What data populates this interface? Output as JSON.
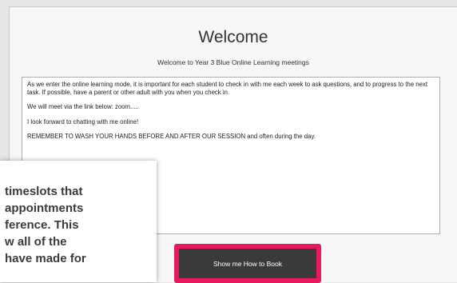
{
  "page": {
    "title": "Welcome",
    "subtitle": "Welcome to Year 3 Blue Online Learning meetings"
  },
  "message": {
    "paragraphs": [
      "As we enter the online learning mode, it is important for each student to check in with me each week to ask questions, and to progress to the next task.  If possible, have a parent or other adult with you when you check in.",
      "We will meet via the link below:  zoom.....",
      "I look forward to chatting with me online!",
      "REMEMBER TO WASH YOUR HANDS BEFORE AND AFTER OUR SESSION and often during the day."
    ]
  },
  "button": {
    "label": "Show me How to Book"
  },
  "tooltip": {
    "lines": [
      "timeslots that",
      "appointments",
      "ference. This",
      "w all of the",
      "have made for"
    ]
  },
  "colors": {
    "highlight": "#e8195d",
    "button_bg": "#3a3a3a"
  }
}
